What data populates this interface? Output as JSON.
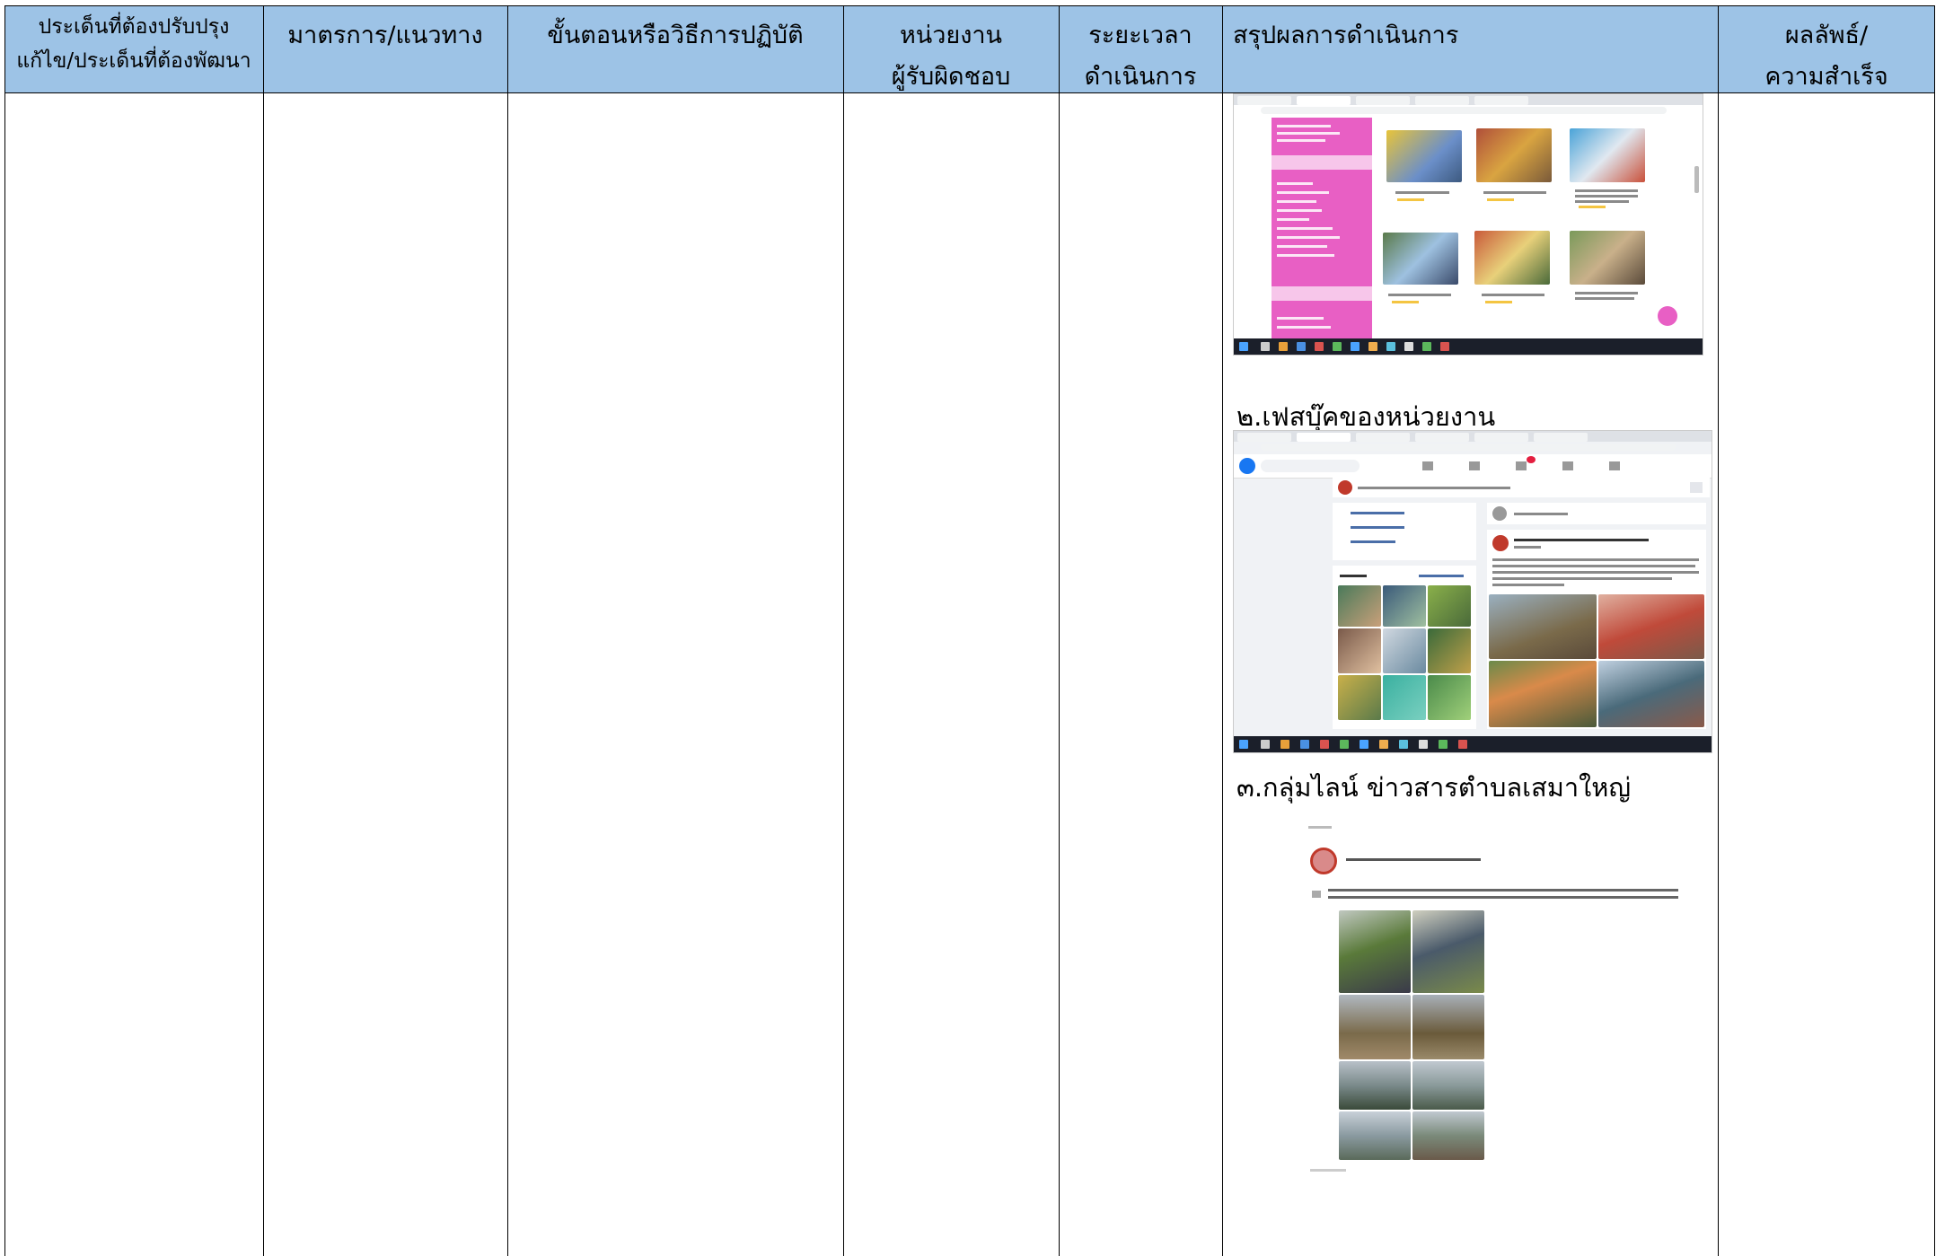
{
  "table": {
    "headers": [
      {
        "line1": "ประเด็นที่ต้องปรับปรุง",
        "line2": "แก้ไข/ประเด็นที่ต้องพัฒนา"
      },
      {
        "line1": "มาตรการ/แนวทาง",
        "line2": ""
      },
      {
        "line1": "ขั้นตอนหรือวิธีการปฏิบัติ",
        "line2": ""
      },
      {
        "line1": "หน่วยงาน",
        "line2": "ผู้รับผิดชอบ"
      },
      {
        "line1": "ระยะเวลา",
        "line2": "ดำเนินการ"
      },
      {
        "line1": "สรุปผลการดำเนินการ",
        "line2": ""
      },
      {
        "line1": "ผลลัพธ์/",
        "line2": "ความสำเร็จ"
      }
    ]
  },
  "results": {
    "caption_facebook": "๒.เฟสบุ๊คของหน่วยงาน",
    "caption_line_group": "๓.กลุ่มไลน์ ข่าวสารตำบลเสมาใหญ่"
  },
  "colors": {
    "header_bg": "#9dc3e6",
    "website_menu": "#e85fc4",
    "facebook_blue": "#1877f2"
  }
}
